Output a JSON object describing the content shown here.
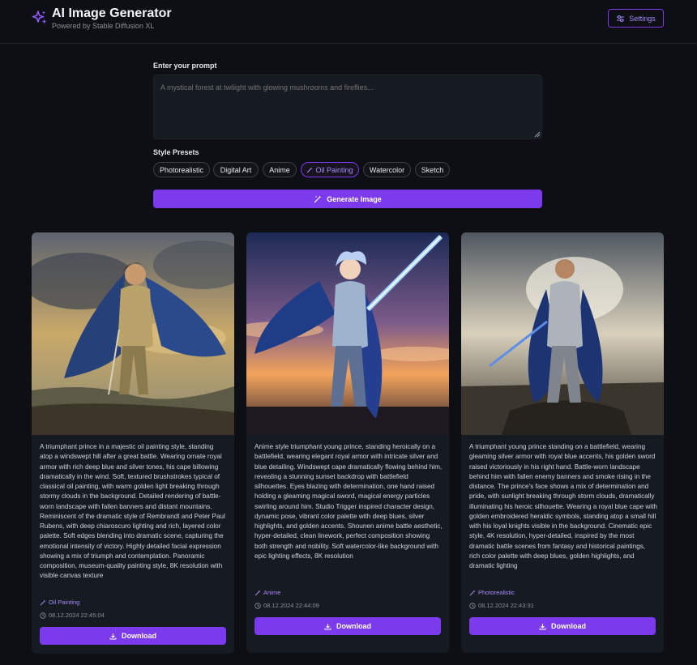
{
  "header": {
    "title": "AI Image Generator",
    "subtitle": "Powered by Stable Diffusion XL",
    "settings_label": "Settings",
    "logo_icon": "sparkles-icon",
    "accent_color": "#7c3aed"
  },
  "prompt": {
    "label": "Enter your prompt",
    "placeholder": "A mystical forest at twilight with glowing mushrooms and fireflies...",
    "value": ""
  },
  "styles": {
    "label": "Style Presets",
    "options": [
      "Photorealistic",
      "Digital Art",
      "Anime",
      "Oil Painting",
      "Watercolor",
      "Sketch"
    ],
    "selected": "Oil Painting"
  },
  "generate": {
    "label": "Generate Image",
    "icon": "magic-wand-icon"
  },
  "cards": [
    {
      "description": "A triumphant prince in a majestic oil painting style, standing atop a windswept hill after a great battle. Wearing ornate royal armor with rich deep blue and silver tones, his cape billowing dramatically in the wind. Soft, textured brushstrokes typical of classical oil painting, with warm golden light breaking through stormy clouds in the background. Detailed rendering of battle-worn landscape with fallen banners and distant mountains. Reminiscent of the dramatic style of Rembrandt and Peter Paul Rubens, with deep chiaroscuro lighting and rich, layered color palette. Soft edges blending into dramatic scene, capturing the emotional intensity of victory. Highly detailed facial expression showing a mix of triumph and contemplation. Panoramic composition, museum-quality painting style, 8K resolution with visible canvas texture",
      "style": "Oil Painting",
      "timestamp": "08.12.2024 22:45:04",
      "download_label": "Download"
    },
    {
      "description": "Anime style triumphant young prince, standing heroically on a battlefield, wearing elegant royal armor with intricate silver and blue detailing. Windswept cape dramatically flowing behind him, revealing a stunning sunset backdrop with battlefield silhouettes. Eyes blazing with determination, one hand raised holding a gleaming magical sword, magical energy particles swirling around him. Studio Trigger inspired character design, dynamic pose, vibrant color palette with deep blues, silver highlights, and golden accents. Shounen anime battle aesthetic, hyper-detailed, clean linework, perfect composition showing both strength and nobility. Soft watercolor-like background with epic lighting effects, 8K resolution",
      "style": "Anime",
      "timestamp": "08.12.2024 22:44:09",
      "download_label": "Download"
    },
    {
      "description": "A triumphant young prince standing on a battlefield, wearing gleaming silver armor with royal blue accents, his golden sword raised victoriously in his right hand. Battle-worn landscape behind him with fallen enemy banners and smoke rising in the distance. The prince's face shows a mix of determination and pride, with sunlight breaking through storm clouds, dramatically illuminating his heroic silhouette. Wearing a royal blue cape with golden embroidered heraldic symbols, standing atop a small hill with his loyal knights visible in the background. Cinematic epic style, 4K resolution, hyper-detailed, inspired by the most dramatic battle scenes from fantasy and historical paintings, rich color palette with deep blues, golden highlights, and dramatic lighting",
      "style": "Photorealistic",
      "timestamp": "08.12.2024 22:43:31",
      "download_label": "Download"
    }
  ]
}
